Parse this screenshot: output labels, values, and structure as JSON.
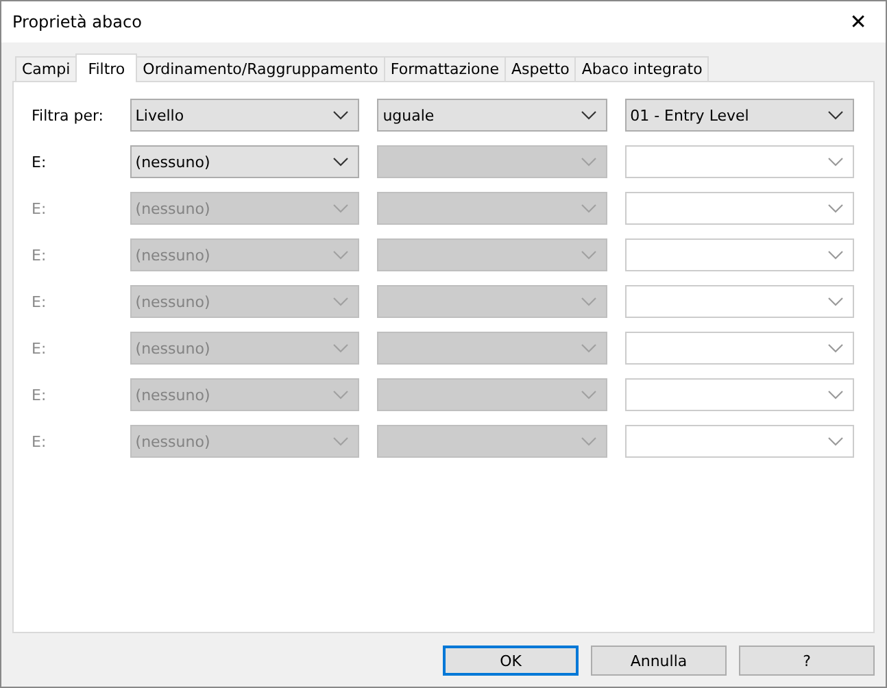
{
  "window": {
    "title": "Proprietà abaco",
    "close": "✕"
  },
  "tabs": [
    {
      "label": "Campi",
      "selected": false
    },
    {
      "label": "Filtro",
      "selected": true
    },
    {
      "label": "Ordinamento/Raggruppamento",
      "selected": false
    },
    {
      "label": "Formattazione",
      "selected": false
    },
    {
      "label": "Aspetto",
      "selected": false
    },
    {
      "label": "Abaco integrato",
      "selected": false
    }
  ],
  "filters": [
    {
      "label": "Filtra per:",
      "disabled": false,
      "combos": [
        {
          "kind": "list",
          "value": "Livello",
          "disabled": false
        },
        {
          "kind": "list",
          "value": "uguale",
          "disabled": false
        },
        {
          "kind": "editable",
          "value": "01 - Entry Level",
          "disabled": false
        }
      ]
    },
    {
      "label": "E:",
      "disabled": false,
      "combos": [
        {
          "kind": "list",
          "value": "(nessuno)",
          "disabled": false
        },
        {
          "kind": "list",
          "disabled": true
        },
        {
          "kind": "editable",
          "disabled": true
        }
      ]
    },
    {
      "label": "E:",
      "disabled": true,
      "combos": [
        {
          "kind": "list",
          "value": "(nessuno)",
          "disabled": true
        },
        {
          "kind": "list",
          "disabled": true
        },
        {
          "kind": "editable",
          "disabled": true
        }
      ]
    },
    {
      "label": "E:",
      "disabled": true,
      "combos": [
        {
          "kind": "list",
          "value": "(nessuno)",
          "disabled": true
        },
        {
          "kind": "list",
          "disabled": true
        },
        {
          "kind": "editable",
          "disabled": true
        }
      ]
    },
    {
      "label": "E:",
      "disabled": true,
      "combos": [
        {
          "kind": "list",
          "value": "(nessuno)",
          "disabled": true
        },
        {
          "kind": "list",
          "disabled": true
        },
        {
          "kind": "editable",
          "disabled": true
        }
      ]
    },
    {
      "label": "E:",
      "disabled": true,
      "combos": [
        {
          "kind": "list",
          "value": "(nessuno)",
          "disabled": true
        },
        {
          "kind": "list",
          "disabled": true
        },
        {
          "kind": "editable",
          "disabled": true
        }
      ]
    },
    {
      "label": "E:",
      "disabled": true,
      "combos": [
        {
          "kind": "list",
          "value": "(nessuno)",
          "disabled": true
        },
        {
          "kind": "list",
          "disabled": true
        },
        {
          "kind": "editable",
          "disabled": true
        }
      ]
    },
    {
      "label": "E:",
      "disabled": true,
      "combos": [
        {
          "kind": "list",
          "value": "(nessuno)",
          "disabled": true
        },
        {
          "kind": "list",
          "disabled": true
        },
        {
          "kind": "editable",
          "disabled": true
        }
      ]
    }
  ],
  "buttons": [
    {
      "label": "OK",
      "default": true
    },
    {
      "label": "Annulla",
      "default": false
    },
    {
      "label": "?",
      "default": false
    }
  ]
}
